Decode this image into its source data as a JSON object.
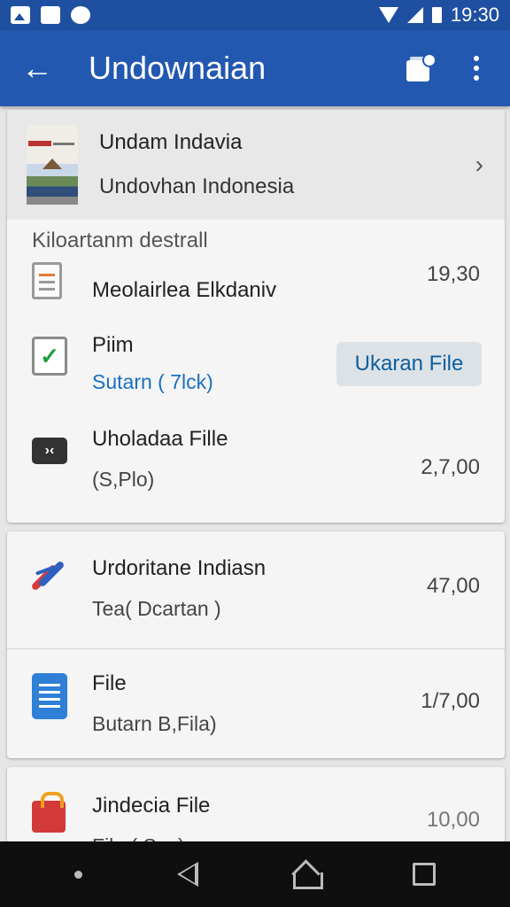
{
  "status_bar": {
    "time": "19:30",
    "icons": [
      "image-icon",
      "app-icon",
      "settings-icon",
      "wifi-icon",
      "signal-icon",
      "battery-icon"
    ]
  },
  "app_bar": {
    "back_icon": "arrow-back-icon",
    "back_glyph": "←",
    "title": "Undownaian",
    "share_icon": "share-icon",
    "overflow_icon": "more-vert-icon",
    "color": "#2358b0"
  },
  "featured": {
    "title": "Undam Indavia",
    "subtitle": "Undovhan Indonesia",
    "chevron": "›"
  },
  "section_header": "Kiloartanm destrall",
  "rows": [
    {
      "title": "Meolairlea Elkdaniv",
      "subtitle": "",
      "value": "19,30",
      "icon": "document-icon"
    },
    {
      "title": "Piim",
      "subtitle": "Sutarn ( 7lck)",
      "value": "",
      "icon": "checkbox-icon",
      "button_label": "Ukaran File"
    },
    {
      "title": "Uholadaa Fille",
      "subtitle": "(S,Plo)",
      "value": "2,7,00",
      "icon": "expand-icon"
    },
    {
      "title": "Urdoritane Indiasn",
      "subtitle": "Tea( Dcartan )",
      "value": "47,00",
      "icon": "brand-slash-icon"
    },
    {
      "title": "File",
      "subtitle": "Butarn B,Fila)",
      "value": "1/7,00",
      "icon": "list-icon"
    },
    {
      "title": "Jindecia File",
      "subtitle": "File ( Sax)",
      "value": "10,00",
      "icon": "bag-icon"
    }
  ],
  "glyphs": {
    "check": "✓",
    "expand": "›‹"
  },
  "nav_bar": {
    "items": [
      "dot",
      "back",
      "home",
      "recents"
    ]
  }
}
